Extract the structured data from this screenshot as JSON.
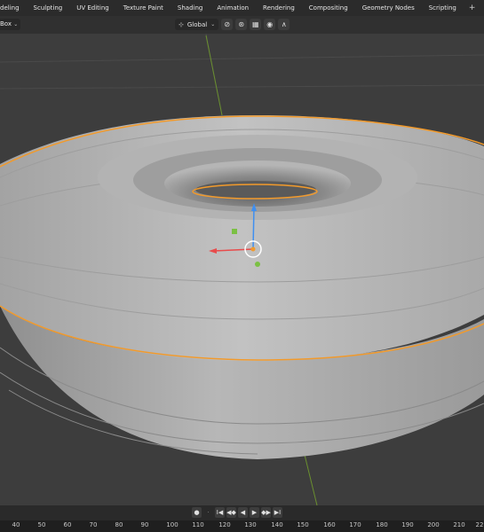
{
  "workspace_tabs": [
    "deling",
    "Sculpting",
    "UV Editing",
    "Texture Paint",
    "Shading",
    "Animation",
    "Rendering",
    "Compositing",
    "Geometry Nodes",
    "Scripting"
  ],
  "add_tab_label": "+",
  "header": {
    "select_mode": "Box",
    "orientation": "Global"
  },
  "playback": {
    "keyframe_dot": "●",
    "jump_start": "I◀",
    "prev_key": "◀◆",
    "play_reverse": "◀",
    "play": "▶",
    "next_key": "◆▶",
    "jump_end": "▶I"
  },
  "timeline_ticks": [
    "40",
    "50",
    "60",
    "70",
    "80",
    "90",
    "100",
    "110",
    "120",
    "130",
    "140",
    "150",
    "160",
    "170",
    "180",
    "190",
    "200",
    "210",
    "22"
  ],
  "colors": {
    "selection_outline": "#f29a2b",
    "x_axis": "#e84b4b",
    "y_axis": "#7bc043",
    "z_axis": "#3f8ff0",
    "viewport_bg": "#3d3d3d"
  },
  "viewport": {
    "object": "torus-mesh",
    "selected": true
  }
}
